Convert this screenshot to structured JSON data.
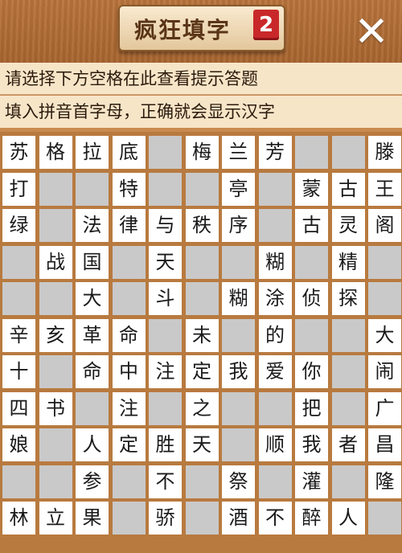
{
  "header": {
    "title": "疯狂填字",
    "level_badge": "2",
    "close_icon": "close-icon"
  },
  "hints": [
    "请选择下方空格在此查看提示答题",
    "填入拼音首字母，正确就会显示汉字"
  ],
  "grid": [
    [
      "苏",
      "格",
      "拉",
      "底",
      null,
      "梅",
      "兰",
      "芳",
      null,
      null,
      "滕"
    ],
    [
      "打",
      null,
      null,
      "特",
      null,
      null,
      "亭",
      null,
      "蒙",
      "古",
      "王"
    ],
    [
      "绿",
      null,
      "法",
      "律",
      "与",
      "秩",
      "序",
      null,
      "古",
      "灵",
      "阁"
    ],
    [
      null,
      "战",
      "国",
      null,
      "天",
      null,
      null,
      "糊",
      null,
      "精",
      null
    ],
    [
      null,
      null,
      "大",
      null,
      "斗",
      null,
      "糊",
      "涂",
      "侦",
      "探",
      null
    ],
    [
      "辛",
      "亥",
      "革",
      "命",
      null,
      "未",
      null,
      "的",
      null,
      null,
      "大"
    ],
    [
      "十",
      null,
      "命",
      "中",
      "注",
      "定",
      "我",
      "爱",
      "你",
      null,
      "闹"
    ],
    [
      "四",
      "书",
      null,
      "注",
      null,
      "之",
      null,
      null,
      "把",
      null,
      "广"
    ],
    [
      "娘",
      null,
      "人",
      "定",
      "胜",
      "天",
      null,
      "顺",
      "我",
      "者",
      "昌"
    ],
    [
      null,
      null,
      "参",
      null,
      "不",
      null,
      "祭",
      null,
      "灌",
      null,
      "隆"
    ],
    [
      "林",
      "立",
      "果",
      null,
      "骄",
      null,
      "酒",
      "不",
      "醉",
      "人",
      null
    ]
  ],
  "colors": {
    "board_frame": "#b87a3f",
    "open_cell": "#ffffff",
    "blocked_cell": "#c9c9c9",
    "hint_bar": "#f7e5c8",
    "badge": "#c9282a"
  }
}
